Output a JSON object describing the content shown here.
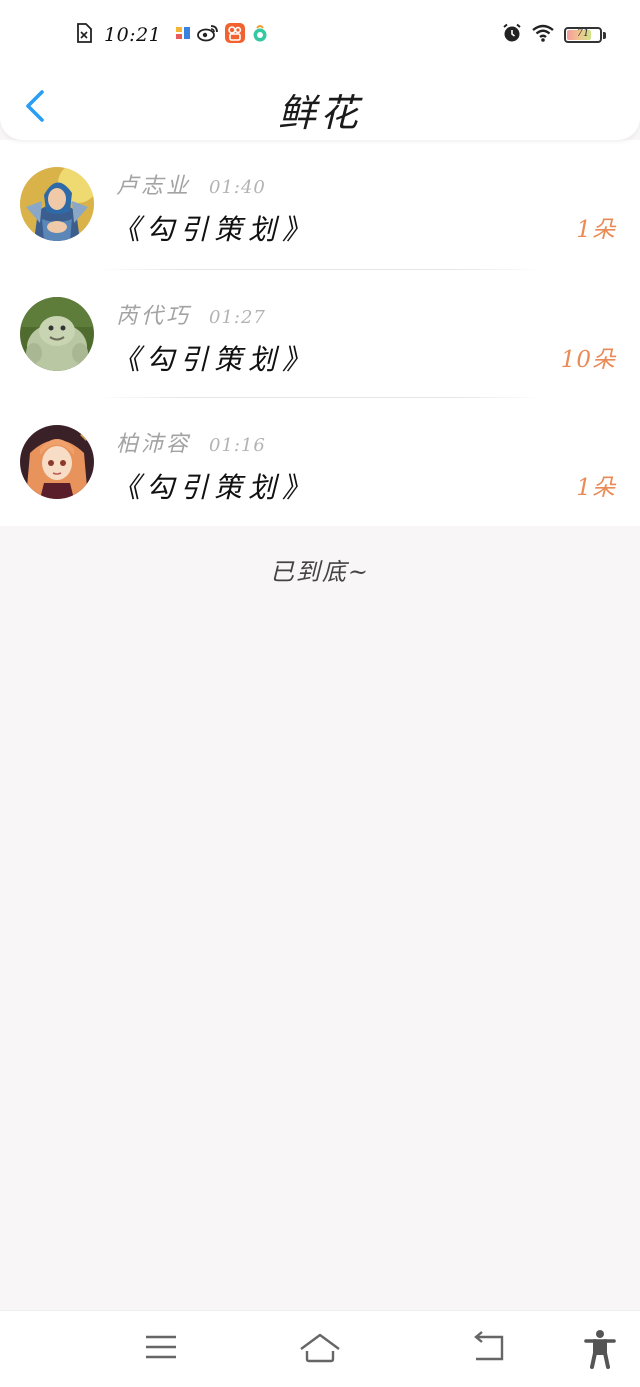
{
  "status_bar": {
    "time": "10:21",
    "battery": "71",
    "battery_level": 0.71,
    "left_icons": [
      "sim-icon",
      "app-icon",
      "weibo-icon",
      "kuaishou-icon",
      "pinduoduo-icon"
    ],
    "right_icons": [
      "alarm-icon",
      "wifi-icon",
      "battery-icon"
    ]
  },
  "header": {
    "title": "鲜花",
    "back_icon": "chevron-left-icon"
  },
  "list": [
    {
      "sender": "卢志业",
      "time": "01:40",
      "title": "《勾引策划》",
      "count": "1朵",
      "avatar": "avatar-warrior"
    },
    {
      "sender": "芮代巧",
      "time": "01:27",
      "title": "《勾引策划》",
      "count": "10朵",
      "avatar": "avatar-ogre"
    },
    {
      "sender": "柏沛容",
      "time": "01:16",
      "title": "《勾引策划》",
      "count": "1朵",
      "avatar": "avatar-anime-girl"
    }
  ],
  "footer_text": "已到底~",
  "nav_bar": {
    "icons": [
      "menu-icon",
      "home-icon",
      "back-icon",
      "accessibility-icon"
    ]
  },
  "colors": {
    "accent": "#2a9df4",
    "count": "#ea8a55",
    "background": "#f8f6f7"
  }
}
